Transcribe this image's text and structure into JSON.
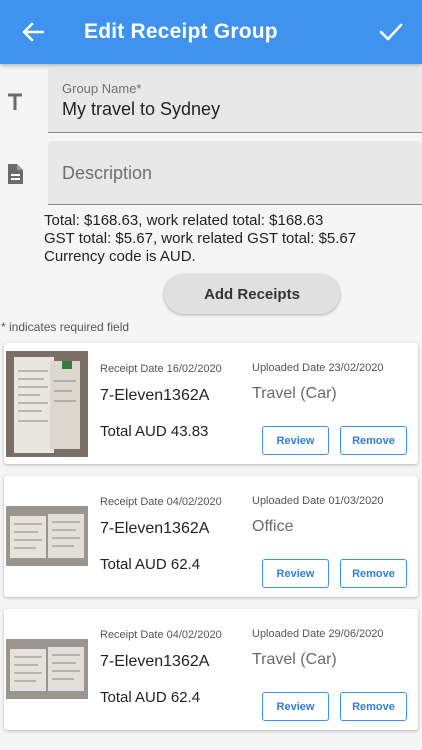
{
  "header": {
    "title": "Edit Receipt Group"
  },
  "form": {
    "group_name_label": "Group Name*",
    "group_name_value": "My travel to Sydney",
    "description_placeholder": "Description"
  },
  "summary": {
    "line1": "Total: $168.63, work related total: $168.63",
    "line2": "GST total: $5.67, work related GST total: $5.67",
    "line3": "Currency code is AUD."
  },
  "add_receipts_label": "Add Receipts",
  "required_note": "* indicates required field",
  "receipts": [
    {
      "receipt_date": "Receipt Date 16/02/2020",
      "uploaded_date": "Uploaded Date 23/02/2020",
      "merchant": "7-Eleven1362A",
      "category": "Travel (Car)",
      "total": "Total AUD 43.83",
      "review_label": "Review",
      "remove_label": "Remove"
    },
    {
      "receipt_date": "Receipt Date 04/02/2020",
      "uploaded_date": "Uploaded Date 01/03/2020",
      "merchant": "7-Eleven1362A",
      "category": "Office",
      "total": "Total AUD 62.4",
      "review_label": "Review",
      "remove_label": "Remove"
    },
    {
      "receipt_date": "Receipt Date 04/02/2020",
      "uploaded_date": "Uploaded Date 29/06/2020",
      "merchant": "7-Eleven1362A",
      "category": "Travel (Car)",
      "total": "Total AUD 62.4",
      "review_label": "Review",
      "remove_label": "Remove"
    }
  ],
  "colors": {
    "appbar": "#3f93ee",
    "button_outline": "#3f93ee"
  },
  "icons": {
    "back": "arrow-left-icon",
    "save": "check-icon",
    "name_field": "text-format-icon",
    "description_field": "document-icon"
  }
}
